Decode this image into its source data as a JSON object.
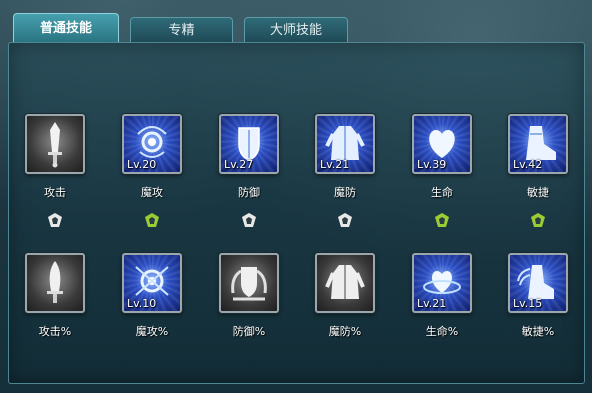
{
  "tabs": [
    {
      "label": "普通技能",
      "active": true
    },
    {
      "label": "专精",
      "active": false
    },
    {
      "label": "大师技能",
      "active": false
    }
  ],
  "skills_top": [
    {
      "name": "攻击",
      "level": "",
      "style": "grey",
      "icon": "sword-icon"
    },
    {
      "name": "魔攻",
      "level": "Lv.20",
      "style": "blue",
      "icon": "magic-orb-icon"
    },
    {
      "name": "防御",
      "level": "Lv.27",
      "style": "blue",
      "icon": "shield-icon"
    },
    {
      "name": "魔防",
      "level": "Lv.21",
      "style": "blue",
      "icon": "robe-icon"
    },
    {
      "name": "生命",
      "level": "Lv.39",
      "style": "blue",
      "icon": "heart-icon"
    },
    {
      "name": "敏捷",
      "level": "Lv.42",
      "style": "blue",
      "icon": "boot-icon"
    }
  ],
  "connectors": [
    {
      "state": "inactive",
      "color": "#e8e8e8"
    },
    {
      "state": "active",
      "color": "#9acd32"
    },
    {
      "state": "inactive",
      "color": "#e8e8e8"
    },
    {
      "state": "inactive",
      "color": "#e8e8e8"
    },
    {
      "state": "active",
      "color": "#9acd32"
    },
    {
      "state": "active",
      "color": "#9acd32"
    }
  ],
  "skills_bottom": [
    {
      "name": "攻击%",
      "level": "",
      "style": "grey",
      "icon": "blade-icon"
    },
    {
      "name": "魔攻%",
      "level": "Lv.10",
      "style": "blue",
      "icon": "magic-spiral-icon"
    },
    {
      "name": "防御%",
      "level": "",
      "style": "grey",
      "icon": "winged-shield-icon"
    },
    {
      "name": "魔防%",
      "level": "",
      "style": "grey",
      "icon": "armor-icon"
    },
    {
      "name": "生命%",
      "level": "Lv.21",
      "style": "blue",
      "icon": "swirl-heart-icon"
    },
    {
      "name": "敏捷%",
      "level": "Lv.15",
      "style": "blue",
      "icon": "winged-boot-icon"
    }
  ]
}
